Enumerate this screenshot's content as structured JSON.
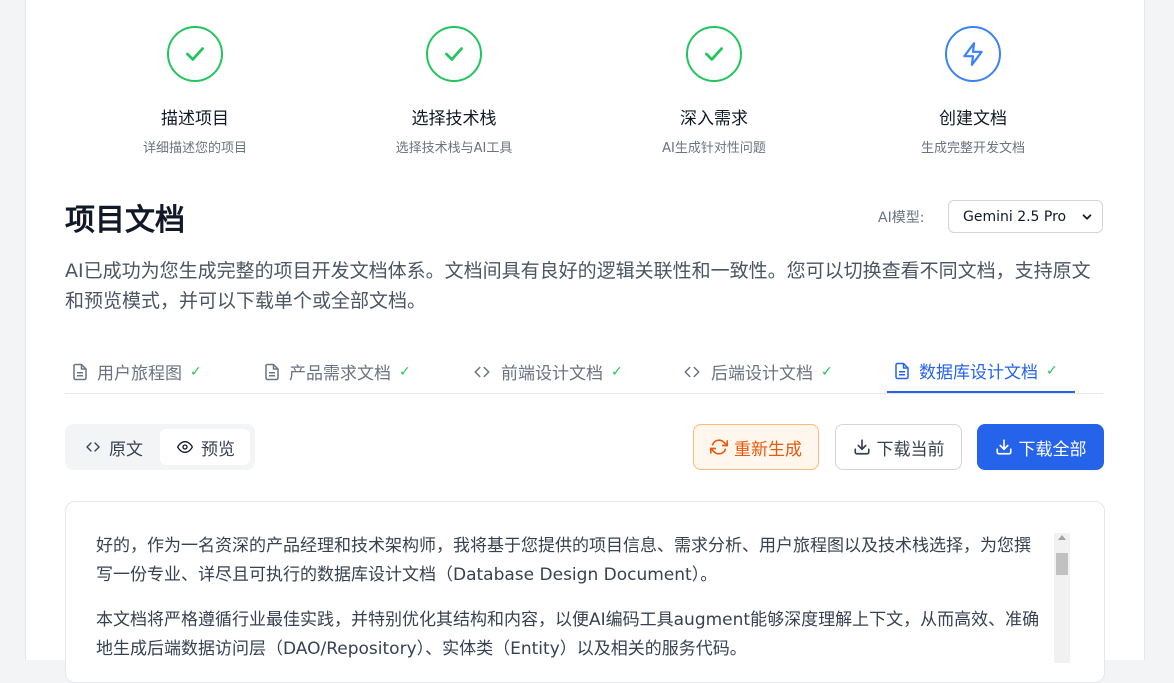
{
  "steps": [
    {
      "title": "描述项目",
      "sub": "详细描述您的项目",
      "icon": "check-icon",
      "status": "done"
    },
    {
      "title": "选择技术栈",
      "sub": "选择技术栈与AI工具",
      "icon": "check-icon",
      "status": "done"
    },
    {
      "title": "深入需求",
      "sub": "AI生成针对性问题",
      "icon": "check-icon",
      "status": "done"
    },
    {
      "title": "创建文档",
      "sub": "生成完整开发文档",
      "icon": "lightning-icon",
      "status": "active"
    }
  ],
  "header": {
    "title": "项目文档",
    "model_label": "AI模型:",
    "model_value": "Gemini 2.5 Pro",
    "description": "AI已成功为您生成完整的项目开发文档体系。文档间具有良好的逻辑关联性和一致性。您可以切换查看不同文档，支持原文和预览模式，并可以下载单个或全部文档。"
  },
  "tabs": [
    {
      "label": "用户旅程图",
      "icon": "file-text-icon"
    },
    {
      "label": "产品需求文档",
      "icon": "file-text-icon"
    },
    {
      "label": "前端设计文档",
      "icon": "code-icon"
    },
    {
      "label": "后端设计文档",
      "icon": "code-icon"
    },
    {
      "label": "数据库设计文档",
      "icon": "file-text-icon",
      "active": true
    }
  ],
  "view_toggle": {
    "raw": "原文",
    "preview": "预览",
    "selected": "preview"
  },
  "actions": {
    "regenerate": "重新生成",
    "download_current": "下载当前",
    "download_all": "下载全部"
  },
  "document": {
    "paragraphs": [
      "好的，作为一名资深的产品经理和技术架构师，我将基于您提供的项目信息、需求分析、用户旅程图以及技术栈选择，为您撰写一份专业、详尽且可执行的数据库设计文档（Database Design Document）。",
      "本文档将严格遵循行业最佳实践，并特别优化其结构和内容，以便AI编码工具augment能够深度理解上下文，从而高效、准确地生成后端数据访问层（DAO/Repository）、实体类（Entity）以及相关的服务代码。"
    ]
  },
  "colors": {
    "success": "#22c55e",
    "accent": "#2563eb",
    "warning": "#ea580c"
  }
}
